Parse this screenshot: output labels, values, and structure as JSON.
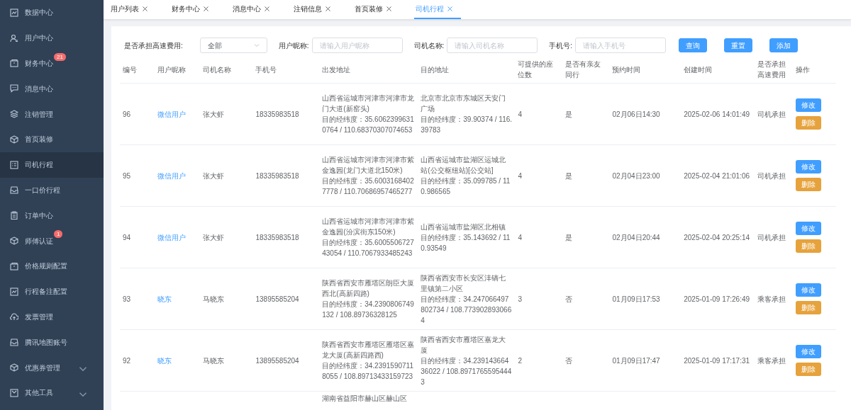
{
  "sidebar": {
    "items": [
      {
        "label": "数据中心",
        "selected": false,
        "expandable": false
      },
      {
        "label": "用户中心",
        "selected": false,
        "expandable": false
      },
      {
        "label": "财务中心",
        "selected": false,
        "expandable": false,
        "badge": "21"
      },
      {
        "label": "消息中心",
        "selected": false,
        "expandable": false
      },
      {
        "label": "注销管理",
        "selected": false,
        "expandable": false
      },
      {
        "label": "首页装修",
        "selected": false,
        "expandable": false
      },
      {
        "label": "司机行程",
        "selected": true,
        "expandable": false
      },
      {
        "label": "一口价行程",
        "selected": false,
        "expandable": false
      },
      {
        "label": "订单中心",
        "selected": false,
        "expandable": false
      },
      {
        "label": "师傅认证",
        "selected": false,
        "expandable": false,
        "badge": "1"
      },
      {
        "label": "价格规则配置",
        "selected": false,
        "expandable": false
      },
      {
        "label": "行程备注配置",
        "selected": false,
        "expandable": false
      },
      {
        "label": "发票管理",
        "selected": false,
        "expandable": false
      },
      {
        "label": "腾讯地图账号",
        "selected": false,
        "expandable": false
      },
      {
        "label": "优惠券管理",
        "selected": false,
        "expandable": true
      },
      {
        "label": "其他工具",
        "selected": false,
        "expandable": true
      }
    ]
  },
  "tabs": [
    {
      "label": "用户列表",
      "selected": false
    },
    {
      "label": "财务中心",
      "selected": false
    },
    {
      "label": "消息中心",
      "selected": false
    },
    {
      "label": "注销信息",
      "selected": false
    },
    {
      "label": "首页装修",
      "selected": false
    },
    {
      "label": "司机行程",
      "selected": true
    }
  ],
  "filters": [
    {
      "kind": "select",
      "label": "是否承担高速费用:",
      "value": "全部"
    },
    {
      "kind": "input",
      "label": "用户昵称:",
      "placeholder": "请输入用户昵称"
    },
    {
      "kind": "input",
      "label": "司机名称:",
      "placeholder": "请输入司机名称"
    },
    {
      "kind": "input",
      "label": "手机号:",
      "placeholder": "请输入手机号"
    }
  ],
  "filter_buttons": [
    "查询",
    "重置",
    "添加"
  ],
  "table": {
    "columns": [
      "编号",
      "用户昵称",
      "司机名称",
      "手机号",
      "出发地址",
      "目的地址",
      "可提供的座位数",
      "是否有亲友同行",
      "预约时间",
      "创建时间",
      "是否承担高速费用",
      "操作"
    ],
    "rows": [
      {
        "id": "96",
        "nickname": "微信用户",
        "driver": "张大虾",
        "phone": "18335983518",
        "departure": [
          "山西省运城市河津市河津市龙门大道(新窑头)",
          "目的经纬度：35.60623996310764 / 110.68370307074653"
        ],
        "destination": [
          "北京市北京市东城区天安门广场",
          "目的经纬度：39.90374 / 116.39783"
        ],
        "seats": "4",
        "companion": "是",
        "appointment": "02月06日14:30",
        "created": "2025-02-06 14:01:49",
        "toll": "司机承担",
        "actions": [
          {
            "kind": "edit",
            "label": "修改"
          },
          {
            "kind": "delete",
            "label": "删除"
          }
        ]
      },
      {
        "id": "95",
        "nickname": "微信用户",
        "driver": "张大虾",
        "phone": "18335983518",
        "departure": [
          "山西省运城市河津市河津市紫金逸园(龙门大道北150米)",
          "目的经纬度：35.60031684027778 / 110.70686957465277"
        ],
        "destination": [
          "山西省运城市盐湖区运城北站(公交枢纽站)[公交站]",
          "目的经纬度：35.099785 / 110.986565"
        ],
        "seats": "4",
        "companion": "是",
        "appointment": "02月04日23:00",
        "created": "2025-02-04 21:01:06",
        "toll": "司机承担",
        "actions": [
          {
            "kind": "edit",
            "label": "修改"
          },
          {
            "kind": "delete",
            "label": "删除"
          }
        ]
      },
      {
        "id": "94",
        "nickname": "微信用户",
        "driver": "张大虾",
        "phone": "18335983518",
        "departure": [
          "山西省运城市河津市河津市紫金逸园(汾滨街东150米)",
          "目的经纬度：35.600550672743054 / 110.7067933485243"
        ],
        "destination": [
          "山西省运城市盐湖区北相镇",
          "目的经纬度：35.143692 / 110.93549"
        ],
        "seats": "4",
        "companion": "是",
        "appointment": "02月04日20:44",
        "created": "2025-02-04 20:25:14",
        "toll": "司机承担",
        "actions": [
          {
            "kind": "edit",
            "label": "修改"
          },
          {
            "kind": "delete",
            "label": "删除"
          }
        ]
      },
      {
        "id": "93",
        "nickname": "晓东",
        "driver": "马晓东",
        "phone": "13895585204",
        "departure": [
          "陕西省西安市雁塔区朗臣大厦西北(高新四路)",
          "目的经纬度：34.2390806749132 / 108.89736328125"
        ],
        "destination": [
          "陕西省西安市长安区沣镐七里镇第二小区",
          "目的经纬度：34.247066497802734 / 108.7739028930664"
        ],
        "seats": "3",
        "companion": "否",
        "appointment": "01月09日17:53",
        "created": "2025-01-09 17:26:49",
        "toll": "乘客承担",
        "actions": [
          {
            "kind": "edit",
            "label": "修改"
          },
          {
            "kind": "delete",
            "label": "删除"
          }
        ]
      },
      {
        "id": "92",
        "nickname": "晓东",
        "driver": "马晓东",
        "phone": "13895585204",
        "departure": [
          "陕西省西安市雁塔区雁塔区嘉龙大厦(高新四路西)",
          "目的经纬度：34.23915907118055 / 108.89713433159723"
        ],
        "destination": [
          "陕西省西安市雁塔区嘉龙大厦",
          "目的经纬度：34.23914366436022 / 108.89717655954443"
        ],
        "seats": "2",
        "companion": "否",
        "appointment": "01月09日17:47",
        "created": "2025-01-09 17:17:31",
        "toll": "乘客承担",
        "actions": [
          {
            "kind": "edit",
            "label": "修改"
          },
          {
            "kind": "delete",
            "label": "删除"
          }
        ]
      },
      {
        "departure": [
          "湖南省益阳市赫山区赫山区"
        ]
      }
    ]
  }
}
